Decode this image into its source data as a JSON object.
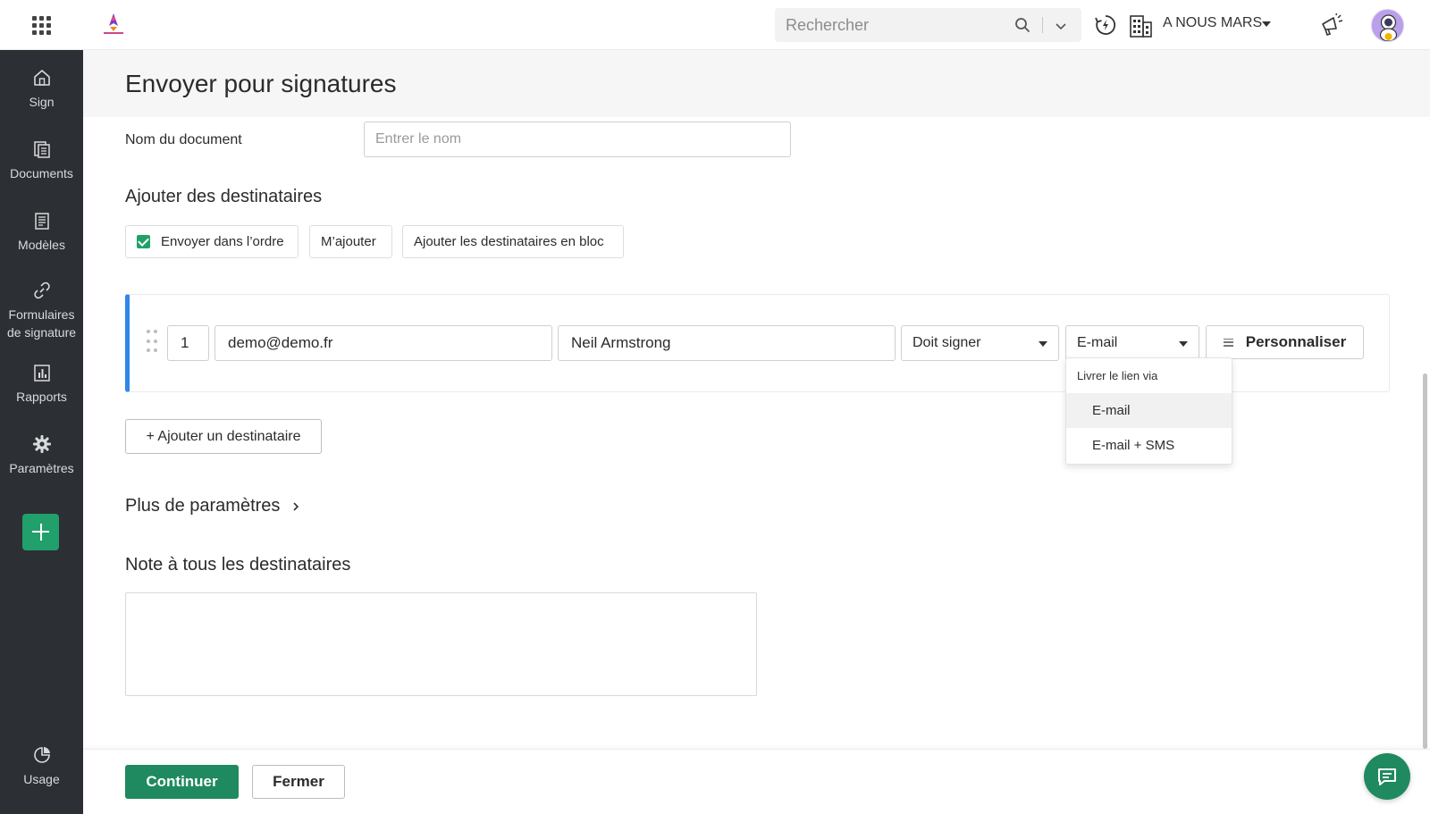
{
  "topbar": {
    "search_placeholder": "Rechercher",
    "org_name": "A NOUS MARS"
  },
  "sidebar": {
    "items": [
      {
        "label": "Sign",
        "icon": "home-icon"
      },
      {
        "label": "Documents",
        "icon": "documents-icon"
      },
      {
        "label": "Modèles",
        "icon": "templates-icon"
      },
      {
        "label": "Formulaires de signature",
        "icon": "link-icon"
      },
      {
        "label": "Rapports",
        "icon": "reports-icon"
      },
      {
        "label": "Paramètres",
        "icon": "gear-icon"
      },
      {
        "label": "Usage",
        "icon": "usage-icon"
      }
    ]
  },
  "page": {
    "title": "Envoyer pour signatures"
  },
  "document": {
    "name_label": "Nom du document",
    "name_placeholder": "Entrer le nom"
  },
  "recipients": {
    "section_title": "Ajouter des destinataires",
    "send_in_order_label": "Envoyer dans l’ordre",
    "add_me_label": "M’ajouter",
    "bulk_add_label": "Ajouter les destinataires en bloc",
    "list": [
      {
        "order": "1",
        "email": "demo@demo.fr",
        "name": "Neil Armstrong",
        "role": "Doit signer",
        "delivery": "E-mail",
        "customize_label": "Personnaliser"
      }
    ],
    "add_recipient_label": "+ Ajouter un destinataire"
  },
  "delivery_dropdown": {
    "header": "Livrer le lien via",
    "options": [
      "E-mail",
      "E-mail + SMS"
    ],
    "selected": "E-mail"
  },
  "more_settings_label": "Plus de paramètres",
  "note": {
    "title": "Note à tous les destinataires"
  },
  "footer": {
    "continue_label": "Continuer",
    "close_label": "Fermer"
  },
  "colors": {
    "sidebar_bg": "#2c2f33",
    "primary_green": "#1f8a5f",
    "accent_blue": "#2f87e8"
  }
}
